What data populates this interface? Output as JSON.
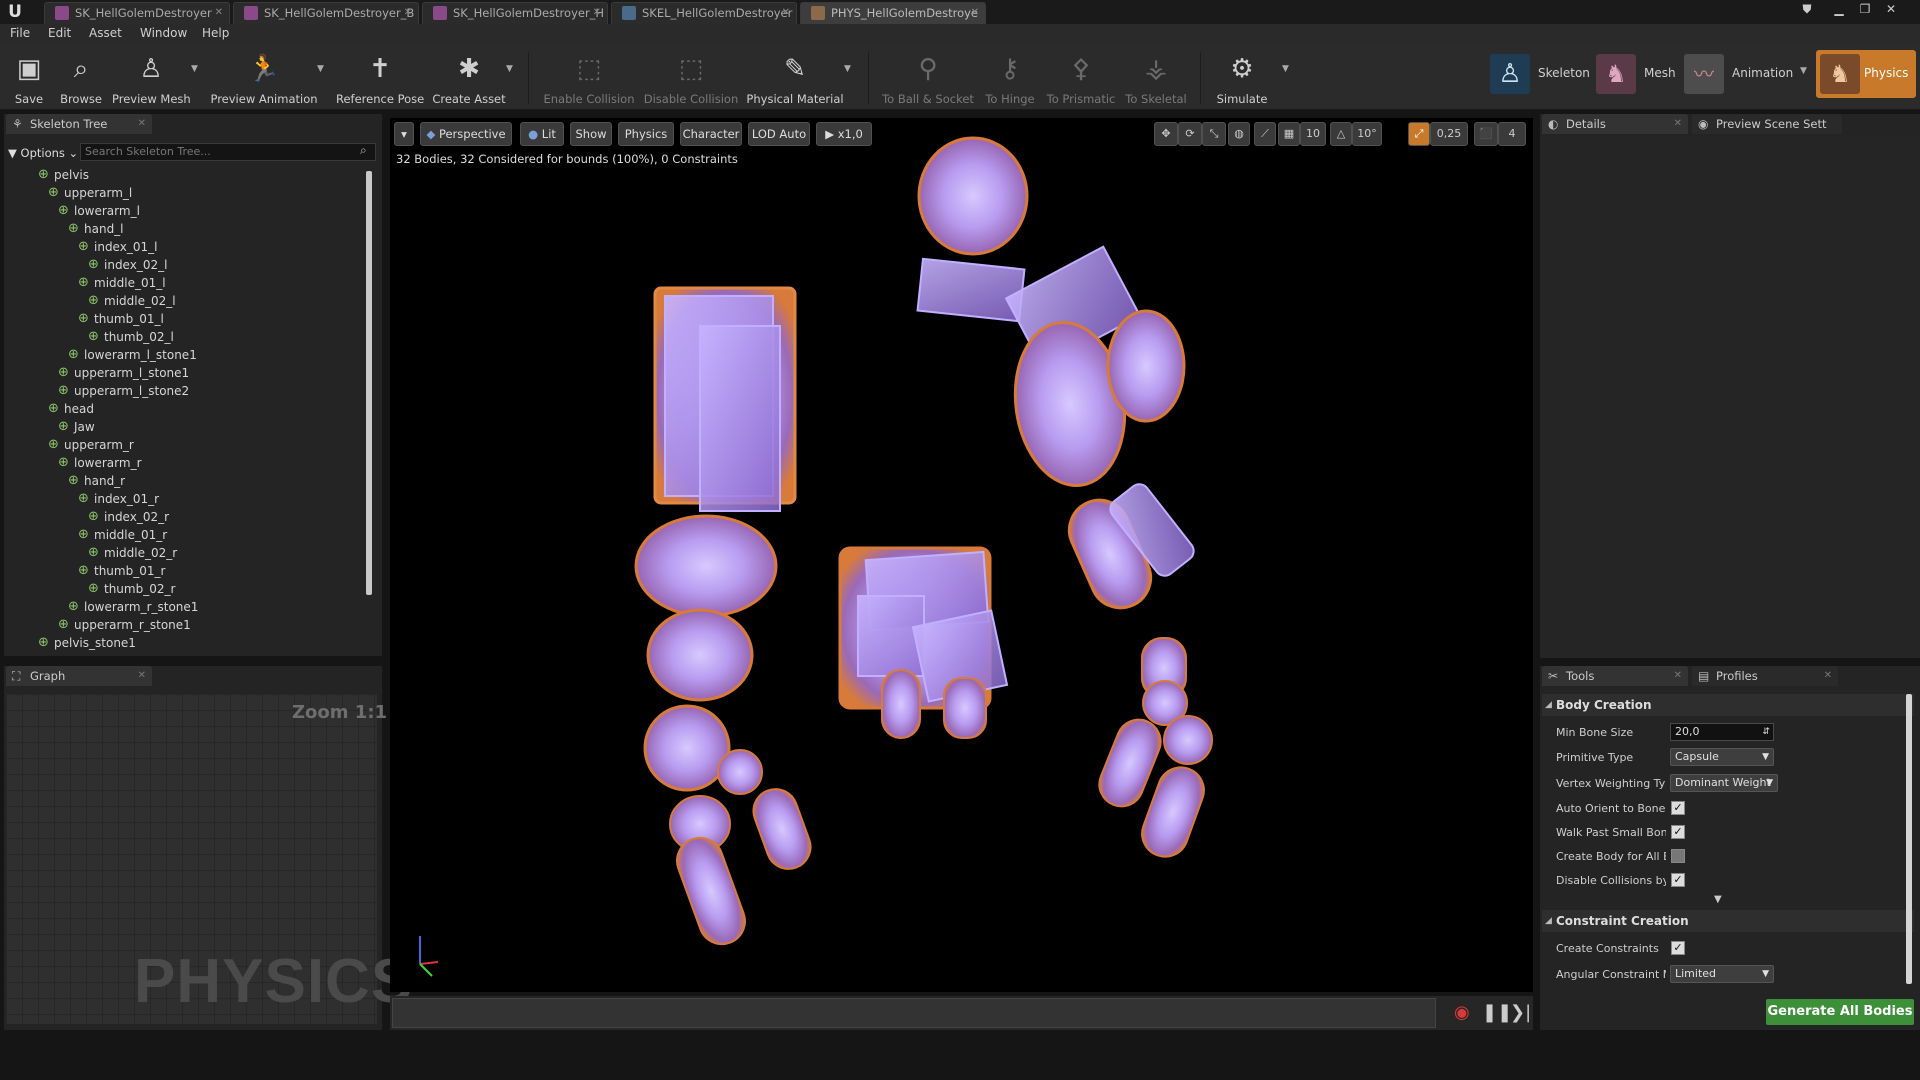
{
  "tabs": [
    {
      "label": "SK_HellGolemDestroyer",
      "icon_color": "#b06ab0"
    },
    {
      "label": "SK_HellGolemDestroyer_B",
      "icon_color": "#b06ab0"
    },
    {
      "label": "SK_HellGolemDestroyer_H",
      "icon_color": "#b06ab0"
    },
    {
      "label": "SKEL_HellGolemDestroyer",
      "icon_color": "#6a8ab0"
    },
    {
      "label": "PHYS_HellGolemDestroye",
      "icon_color": "#b08a6a"
    }
  ],
  "logo": "U",
  "menu": [
    "File",
    "Edit",
    "Asset",
    "Window",
    "Help"
  ],
  "toolbar": {
    "save": "Save",
    "browse": "Browse",
    "preview_mesh": "Preview Mesh",
    "preview_animation": "Preview Animation",
    "reference_pose": "Reference Pose",
    "create_asset": "Create Asset",
    "enable_collision": "Enable Collision",
    "disable_collision": "Disable Collision",
    "physical_material": "Physical Material",
    "to_ball_socket": "To Ball & Socket",
    "to_hinge": "To Hinge",
    "to_prismatic": "To Prismatic",
    "to_skeletal": "To Skeletal",
    "simulate": "Simulate"
  },
  "modes": {
    "skeleton": "Skeleton",
    "mesh": "Mesh",
    "animation": "Animation",
    "physics": "Physics"
  },
  "skeleton_tree": {
    "tab": "Skeleton Tree",
    "options": "Options",
    "search_placeholder": "Search Skeleton Tree...",
    "bones": [
      {
        "name": "pelvis",
        "depth": 0
      },
      {
        "name": "upperarm_l",
        "depth": 1
      },
      {
        "name": "lowerarm_l",
        "depth": 2
      },
      {
        "name": "hand_l",
        "depth": 3
      },
      {
        "name": "index_01_l",
        "depth": 4
      },
      {
        "name": "index_02_l",
        "depth": 5
      },
      {
        "name": "middle_01_l",
        "depth": 4
      },
      {
        "name": "middle_02_l",
        "depth": 5
      },
      {
        "name": "thumb_01_l",
        "depth": 4
      },
      {
        "name": "thumb_02_l",
        "depth": 5
      },
      {
        "name": "lowerarm_l_stone1",
        "depth": 3
      },
      {
        "name": "upperarm_l_stone1",
        "depth": 2
      },
      {
        "name": "upperarm_l_stone2",
        "depth": 2
      },
      {
        "name": "head",
        "depth": 1
      },
      {
        "name": "Jaw",
        "depth": 2
      },
      {
        "name": "upperarm_r",
        "depth": 1
      },
      {
        "name": "lowerarm_r",
        "depth": 2
      },
      {
        "name": "hand_r",
        "depth": 3
      },
      {
        "name": "index_01_r",
        "depth": 4
      },
      {
        "name": "index_02_r",
        "depth": 5
      },
      {
        "name": "middle_01_r",
        "depth": 4
      },
      {
        "name": "middle_02_r",
        "depth": 5
      },
      {
        "name": "thumb_01_r",
        "depth": 4
      },
      {
        "name": "thumb_02_r",
        "depth": 5
      },
      {
        "name": "lowerarm_r_stone1",
        "depth": 3
      },
      {
        "name": "upperarm_r_stone1",
        "depth": 2
      },
      {
        "name": "pelvis_stone1",
        "depth": 0
      }
    ]
  },
  "graph": {
    "tab": "Graph",
    "zoom": "Zoom 1:1",
    "watermark": "PHYSICS"
  },
  "viewport": {
    "perspective": "Perspective",
    "lit": "Lit",
    "show": "Show",
    "physics": "Physics",
    "character": "Character",
    "lod": "LOD Auto",
    "speed": "x1,0",
    "grid_snap": "10",
    "rot_snap": "10°",
    "scale_snap": "0,25",
    "cam_speed": "4",
    "info": "32 Bodies, 32 Considered for bounds (100%), 0 Constraints"
  },
  "details": {
    "tab": "Details",
    "preview_tab": "Preview Scene Sett"
  },
  "tools": {
    "tab": "Tools",
    "profiles_tab": "Profiles",
    "body_creation": "Body Creation",
    "min_bone_size_label": "Min Bone Size",
    "min_bone_size": "20,0",
    "primitive_type_label": "Primitive Type",
    "primitive_type": "Capsule",
    "vertex_weighting_label": "Vertex Weighting Type",
    "vertex_weighting": "Dominant Weight",
    "auto_orient_label": "Auto Orient to Bone",
    "walk_past_label": "Walk Past Small Bones",
    "create_body_label": "Create Body for All Bones",
    "disable_collisions_label": "Disable Collisions by Default",
    "constraint_creation": "Constraint Creation",
    "create_constraints_label": "Create Constraints",
    "angular_constraint_label": "Angular Constraint Mode",
    "angular_constraint": "Limited",
    "generate": "Generate All Bodies"
  },
  "colors": {
    "accent_physics": "#c87a2a",
    "body_fill": "#b4a0ff",
    "generate_green": "#3d8f3a",
    "bone_icon": "#8cc26a"
  }
}
